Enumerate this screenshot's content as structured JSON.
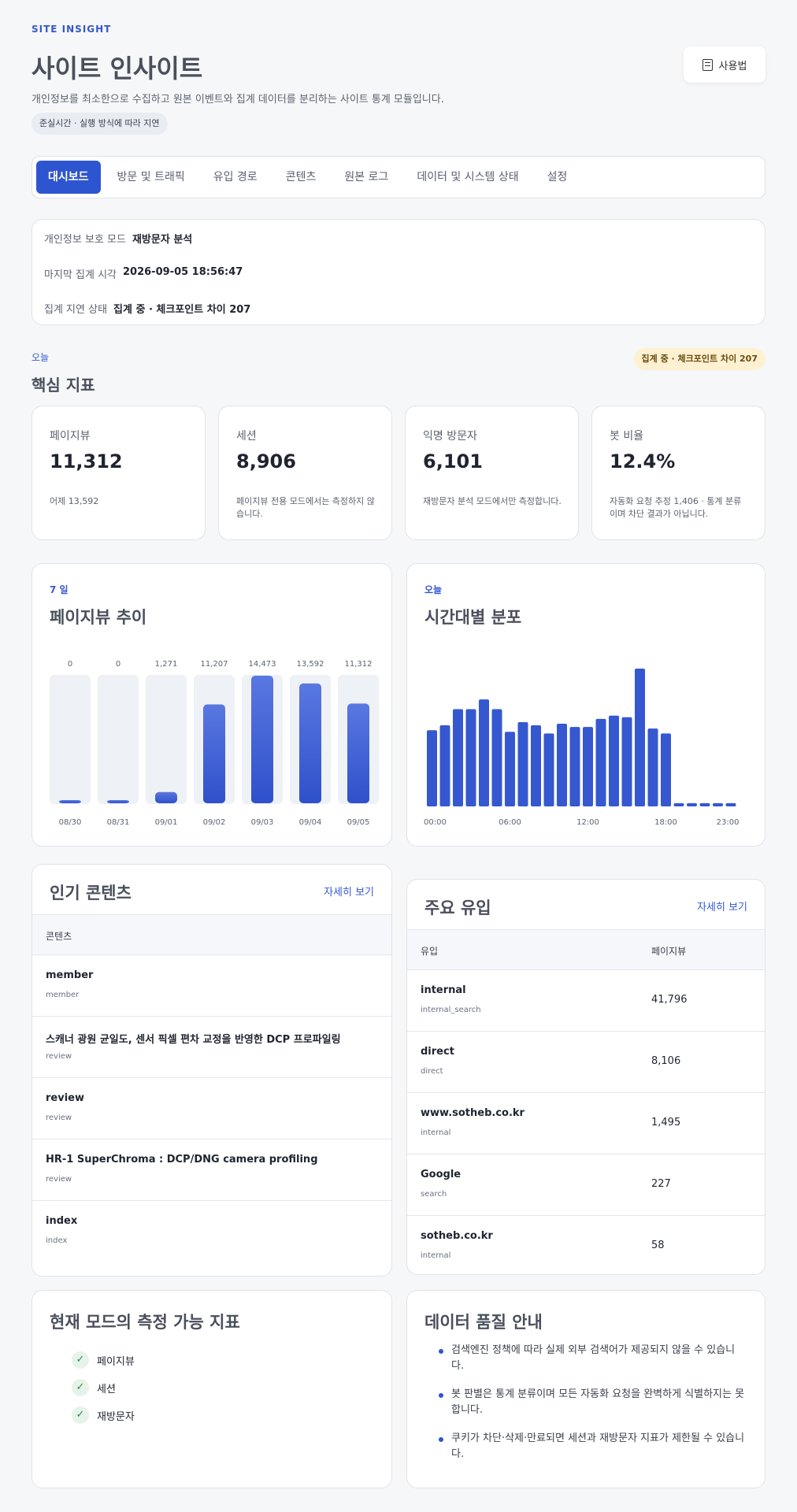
{
  "header": {
    "eyebrow": "SITE INSIGHT",
    "title": "사이트 인사이트",
    "subtitle": "개인정보를 최소한으로 수집하고 원본 이벤트와 집계 데이터를 분리하는 사이트 통계 모듈입니다.",
    "lag_chip": "준실시간 · 실행 방식에 따라 지연",
    "howto_label": "사용법"
  },
  "tabs": [
    {
      "label": "대시보드",
      "active": true
    },
    {
      "label": "방문 및 트래픽"
    },
    {
      "label": "유입 경로"
    },
    {
      "label": "콘텐츠"
    },
    {
      "label": "원본 로그"
    },
    {
      "label": "데이터 및 시스템 상태"
    },
    {
      "label": "설정"
    }
  ],
  "status": {
    "privacy_label": "개인정보 보호 모드",
    "privacy_value": "재방문자 분석",
    "last_label": "마지막 집계 시각",
    "last_value": "2026-09-05 18:56:47",
    "lag_label": "집계 지연 상태",
    "lag_value": "집계 중 · 체크포인트 차이 207"
  },
  "kpi_section": {
    "tag": "오늘",
    "title": "핵심 지표",
    "badge": "집계 중 · 체크포인트 차이 207",
    "cards": [
      {
        "label": "페이지뷰",
        "value": "11,312",
        "note": "어제 13,592"
      },
      {
        "label": "세션",
        "value": "8,906",
        "note": "페이지뷰 전용 모드에서는 측정하지 않습니다."
      },
      {
        "label": "익명 방문자",
        "value": "6,101",
        "note": "재방문자 분석 모드에서만 측정합니다."
      },
      {
        "label": "봇 비율",
        "value": "12.4%",
        "note": "자동화 요청 추정 1,406 · 통계 분류이며 차단 결과가 아닙니다."
      }
    ]
  },
  "pageview_chart": {
    "tag": "7 일",
    "title": "페이지뷰 추이"
  },
  "hourly_chart": {
    "tag": "오늘",
    "title": "시간대별 분포"
  },
  "chart_data": [
    {
      "type": "bar",
      "categories": [
        "08/30",
        "08/31",
        "09/01",
        "09/02",
        "09/03",
        "09/04",
        "09/05"
      ],
      "values": [
        0,
        0,
        1271,
        11207,
        14473,
        13592,
        11312
      ],
      "value_labels": [
        "0",
        "0",
        "1,271",
        "11,207",
        "14,473",
        "13,592",
        "11,312"
      ],
      "ylim": [
        0,
        14473
      ]
    },
    {
      "type": "bar",
      "x": [
        "00",
        "01",
        "02",
        "03",
        "04",
        "05",
        "06",
        "07",
        "08",
        "09",
        "10",
        "11",
        "12",
        "13",
        "14",
        "15",
        "16",
        "17",
        "18",
        "19",
        "20",
        "21",
        "22",
        "23"
      ],
      "values": [
        47,
        50,
        60,
        60,
        66,
        60,
        46,
        52,
        50,
        45,
        51,
        49,
        49,
        54,
        56,
        55,
        85,
        48,
        45,
        2,
        2,
        2,
        2,
        2
      ],
      "tick_labels": [
        "00:00",
        "06:00",
        "12:00",
        "18:00",
        "23:00"
      ],
      "ylim": [
        0,
        85
      ]
    }
  ],
  "top_content": {
    "title": "인기 콘텐츠",
    "more": "자세히 보기",
    "col": "콘텐츠",
    "rows": [
      {
        "main": "member",
        "sub": "member"
      },
      {
        "main": "스캐너 광원 균일도, 센서 픽셀 편차 교정을 반영한 DCP 프로파일링",
        "sub": "review"
      },
      {
        "main": "review",
        "sub": "review"
      },
      {
        "main": "HR-1 SuperChroma : DCP/DNG camera profiling",
        "sub": "review"
      },
      {
        "main": "index",
        "sub": "index"
      }
    ]
  },
  "top_referrers": {
    "title": "주요 유입",
    "more": "자세히 보기",
    "col_source": "유입",
    "col_views": "페이지뷰",
    "rows": [
      {
        "main": "internal",
        "sub": "internal_search",
        "views": "41,796"
      },
      {
        "main": "direct",
        "sub": "direct",
        "views": "8,106"
      },
      {
        "main": "www.sotheb.co.kr",
        "sub": "internal",
        "views": "1,495"
      },
      {
        "main": "Google",
        "sub": "search",
        "views": "227"
      },
      {
        "main": "sotheb.co.kr",
        "sub": "internal",
        "views": "58"
      }
    ]
  },
  "metrics_card": {
    "title": "현재 모드의 측정 가능 지표",
    "items": [
      "페이지뷰",
      "세션",
      "재방문자"
    ]
  },
  "quality_card": {
    "title": "데이터 품질 안내",
    "items": [
      "검색엔진 정책에 따라 실제 외부 검색어가 제공되지 않을 수 있습니다.",
      "봇 판별은 통계 분류이며 모든 자동화 요청을 완벽하게 식별하지는 못합니다.",
      "쿠키가 차단·삭제·만료되면 세션과 재방문자 지표가 제한될 수 있습니다."
    ]
  },
  "colors": {
    "accent": "#2e55d0",
    "bar": "#3558d0",
    "bar_track": "#eef1f6",
    "warn_bg": "#fdf1d2"
  }
}
